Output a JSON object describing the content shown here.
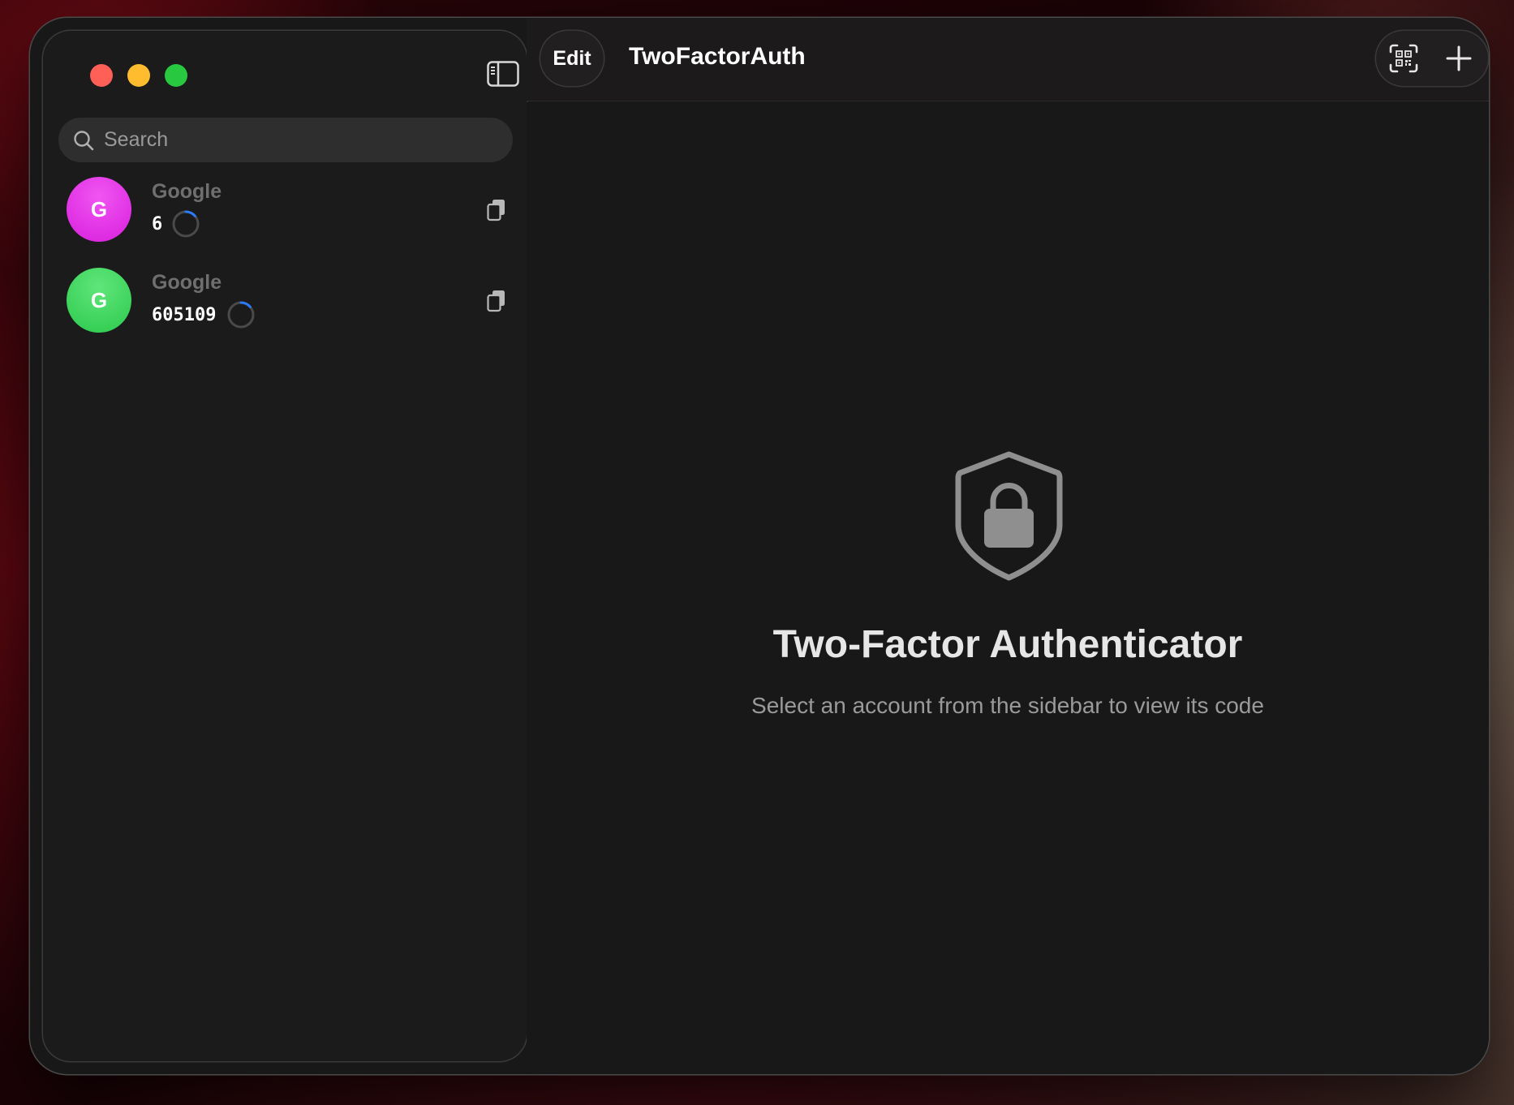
{
  "app": {
    "title": "TwoFactorAuth"
  },
  "toolbar": {
    "edit_label": "Edit",
    "scan_icon": "qr-scan-icon",
    "add_icon": "plus-icon"
  },
  "sidebar": {
    "toggle_icon": "sidebar-toggle-icon",
    "search": {
      "placeholder": "Search"
    },
    "accounts": [
      {
        "name": "Google",
        "initial": "G",
        "code": "6",
        "avatar_color": "#e52ee8",
        "timer_remaining": 0.12
      },
      {
        "name": "Google",
        "initial": "G",
        "code": "605109",
        "avatar_color": "#3ad45a",
        "timer_remaining": 0.12
      }
    ]
  },
  "empty_state": {
    "icon": "shield-lock-icon",
    "title": "Two-Factor Authenticator",
    "subtitle": "Select an account from the sidebar to view its code"
  },
  "colors": {
    "timer_accent": "#2a7bf6",
    "close": "#fe5f57",
    "minimize": "#febc2e",
    "zoom": "#28c840"
  }
}
